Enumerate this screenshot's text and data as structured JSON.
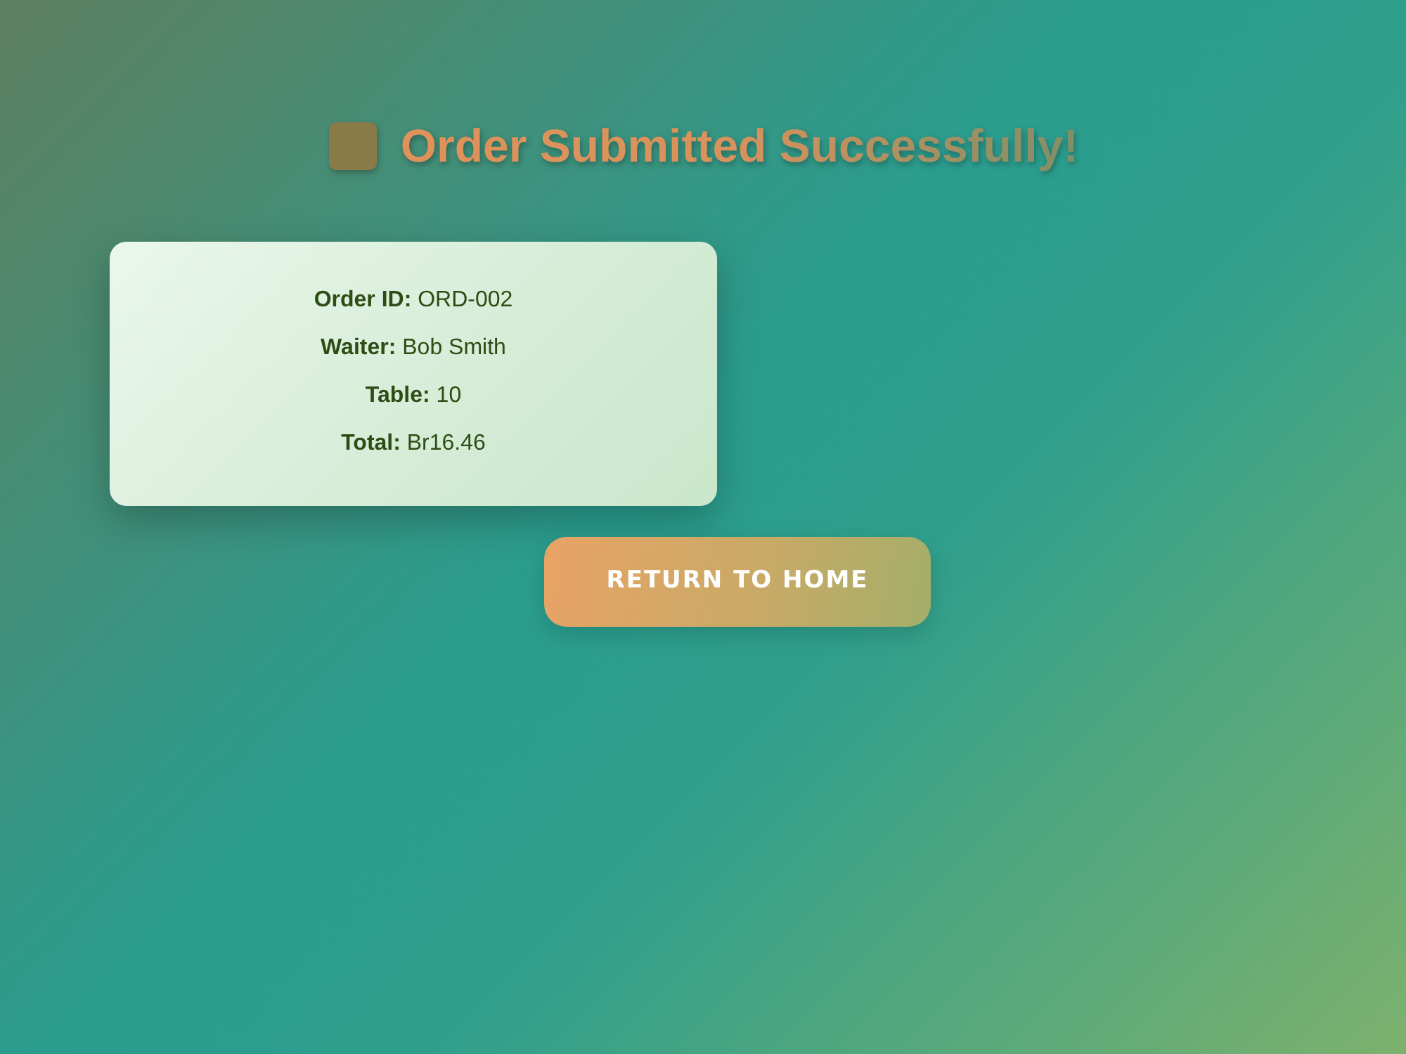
{
  "heading": {
    "title": "Order Submitted Successfully!"
  },
  "order_details": [
    {
      "text": "**Order ID:** ORD-002"
    },
    {
      "text": "**Waiter:** Bob Smith"
    },
    {
      "text": "**Table:** 10"
    },
    {
      "text": "**Total:** Br16.46"
    }
  ],
  "buttons": [
    {
      "label": "RETURN TO HOME"
    }
  ]
}
